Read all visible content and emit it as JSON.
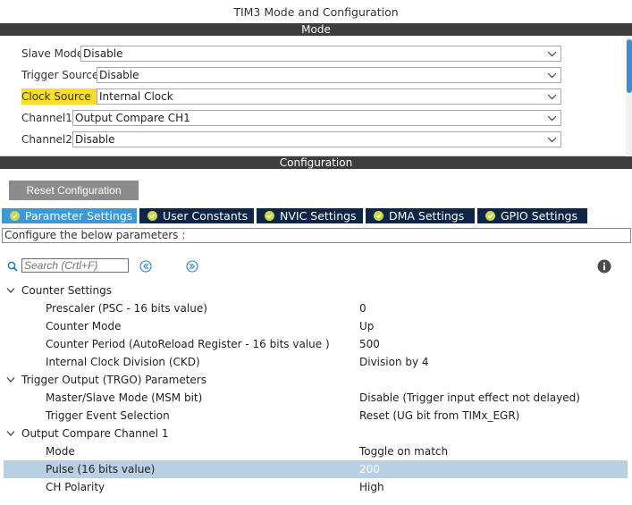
{
  "window": {
    "title": "TIM3 Mode and Configuration"
  },
  "sections": {
    "mode": "Mode",
    "configuration": "Configuration"
  },
  "mode": {
    "rows": [
      {
        "label": "Slave Mode",
        "value": "Disable"
      },
      {
        "label": "Trigger Source",
        "value": "Disable"
      },
      {
        "label": "Clock Source",
        "value": "Internal Clock"
      },
      {
        "label": "Channel1",
        "value": "Output Compare CH1"
      },
      {
        "label": "Channel2",
        "value": "Disable"
      }
    ]
  },
  "reset_label": "Reset Configuration",
  "tabs": [
    {
      "label": "Parameter Settings"
    },
    {
      "label": "User Constants"
    },
    {
      "label": "NVIC Settings"
    },
    {
      "label": "DMA Settings"
    },
    {
      "label": "GPIO Settings"
    }
  ],
  "instructions": "Configure the below parameters :",
  "search": {
    "placeholder": "Search (Crtl+F)"
  },
  "tree": {
    "groups": [
      {
        "name": "Counter Settings",
        "params": [
          {
            "name": "Prescaler (PSC - 16 bits value)",
            "value": "0"
          },
          {
            "name": "Counter Mode",
            "value": "Up"
          },
          {
            "name": "Counter Period (AutoReload Register - 16 bits value )",
            "value": "500"
          },
          {
            "name": "Internal Clock Division (CKD)",
            "value": "Division by 4"
          }
        ]
      },
      {
        "name": "Trigger Output (TRGO) Parameters",
        "params": [
          {
            "name": "Master/Slave Mode (MSM bit)",
            "value": "Disable (Trigger input effect not delayed)"
          },
          {
            "name": "Trigger Event Selection",
            "value": "Reset (UG bit from TIMx_EGR)"
          }
        ]
      },
      {
        "name": "Output Compare Channel 1",
        "params": [
          {
            "name": "Mode",
            "value": "Toggle on match"
          },
          {
            "name": "Pulse (16 bits value)",
            "value": "200"
          },
          {
            "name": "CH Polarity",
            "value": "High"
          }
        ]
      }
    ]
  },
  "colors": {
    "section_bar": "#3d3d3d",
    "tab_active": "#3f98d6",
    "tab_inactive": "#0d2648",
    "tab_check": "#c8d84a",
    "highlight": "#f7dc2a",
    "selected_row": "#b8cfe4",
    "scroll_thumb": "#3c8dd8"
  },
  "icons": {
    "search": "search-icon",
    "prev": "prev-circle-icon",
    "next": "next-circle-icon",
    "info": "info-icon",
    "dropdown": "chevron-down-icon",
    "tab_ok": "check-circle-icon",
    "expand": "caret-down-icon"
  }
}
